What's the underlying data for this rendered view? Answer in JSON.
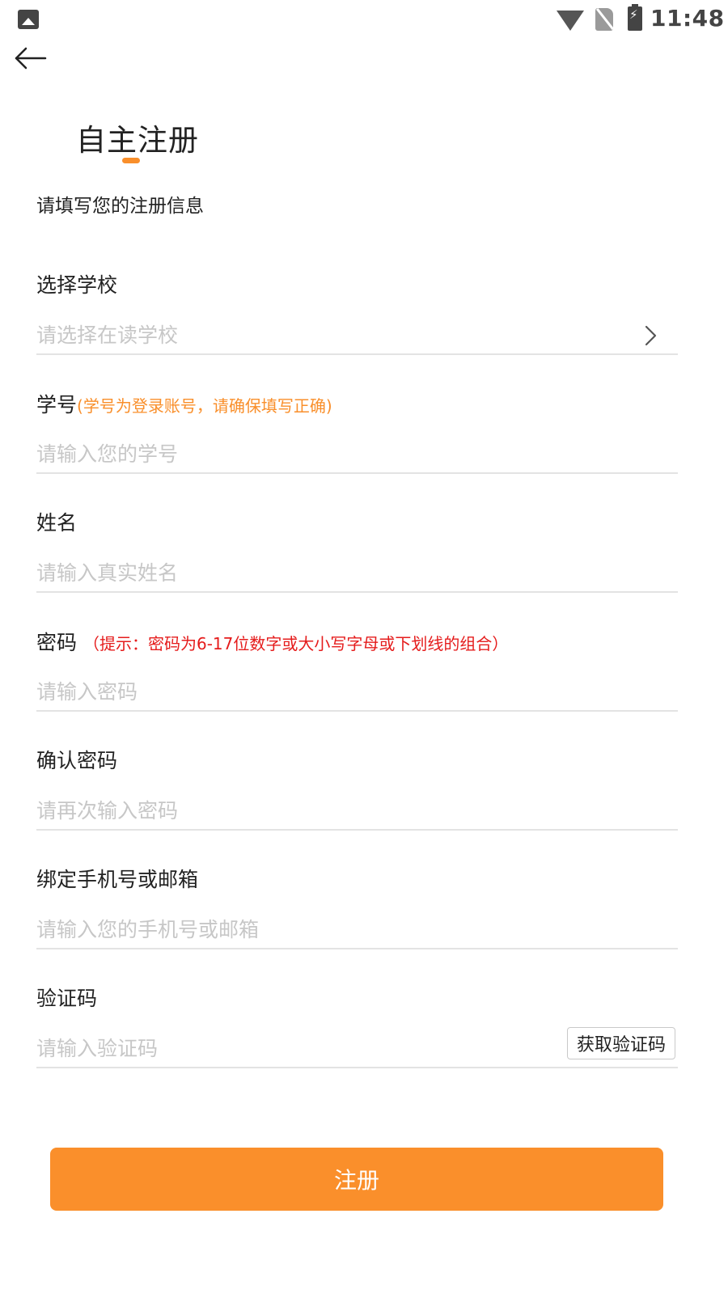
{
  "status_bar": {
    "time": "11:48",
    "icons": [
      "image-icon",
      "wifi-icon",
      "no-sim-icon",
      "battery-charging-icon"
    ]
  },
  "header": {
    "back_icon": "arrow-left-icon",
    "title": "自主注册",
    "subtitle": "请填写您的注册信息",
    "accent_color": "#f98f2b"
  },
  "form": {
    "school": {
      "label": "选择学校",
      "placeholder": "请选择在读学校",
      "icon": "chevron-right-icon"
    },
    "student_id": {
      "label": "学号",
      "hint": "(学号为登录账号，请确保填写正确)",
      "placeholder": "请输入您的学号"
    },
    "name": {
      "label": "姓名",
      "placeholder": "请输入真实姓名"
    },
    "password": {
      "label": "密码",
      "hint": "（提示：密码为6-17位数字或大小写字母或下划线的组合）",
      "placeholder": "请输入密码"
    },
    "confirm_password": {
      "label": "确认密码",
      "placeholder": "请再次输入密码"
    },
    "contact": {
      "label": "绑定手机号或邮箱",
      "placeholder": "请输入您的手机号或邮箱"
    },
    "verification_code": {
      "label": "验证码",
      "placeholder": "请输入验证码",
      "button": "获取验证码"
    }
  },
  "submit": {
    "label": "注册",
    "color": "#fa8f2b"
  },
  "colors": {
    "hint_orange": "#f98f2b",
    "hint_red": "#e51c1c",
    "placeholder": "#c7c7c7"
  }
}
